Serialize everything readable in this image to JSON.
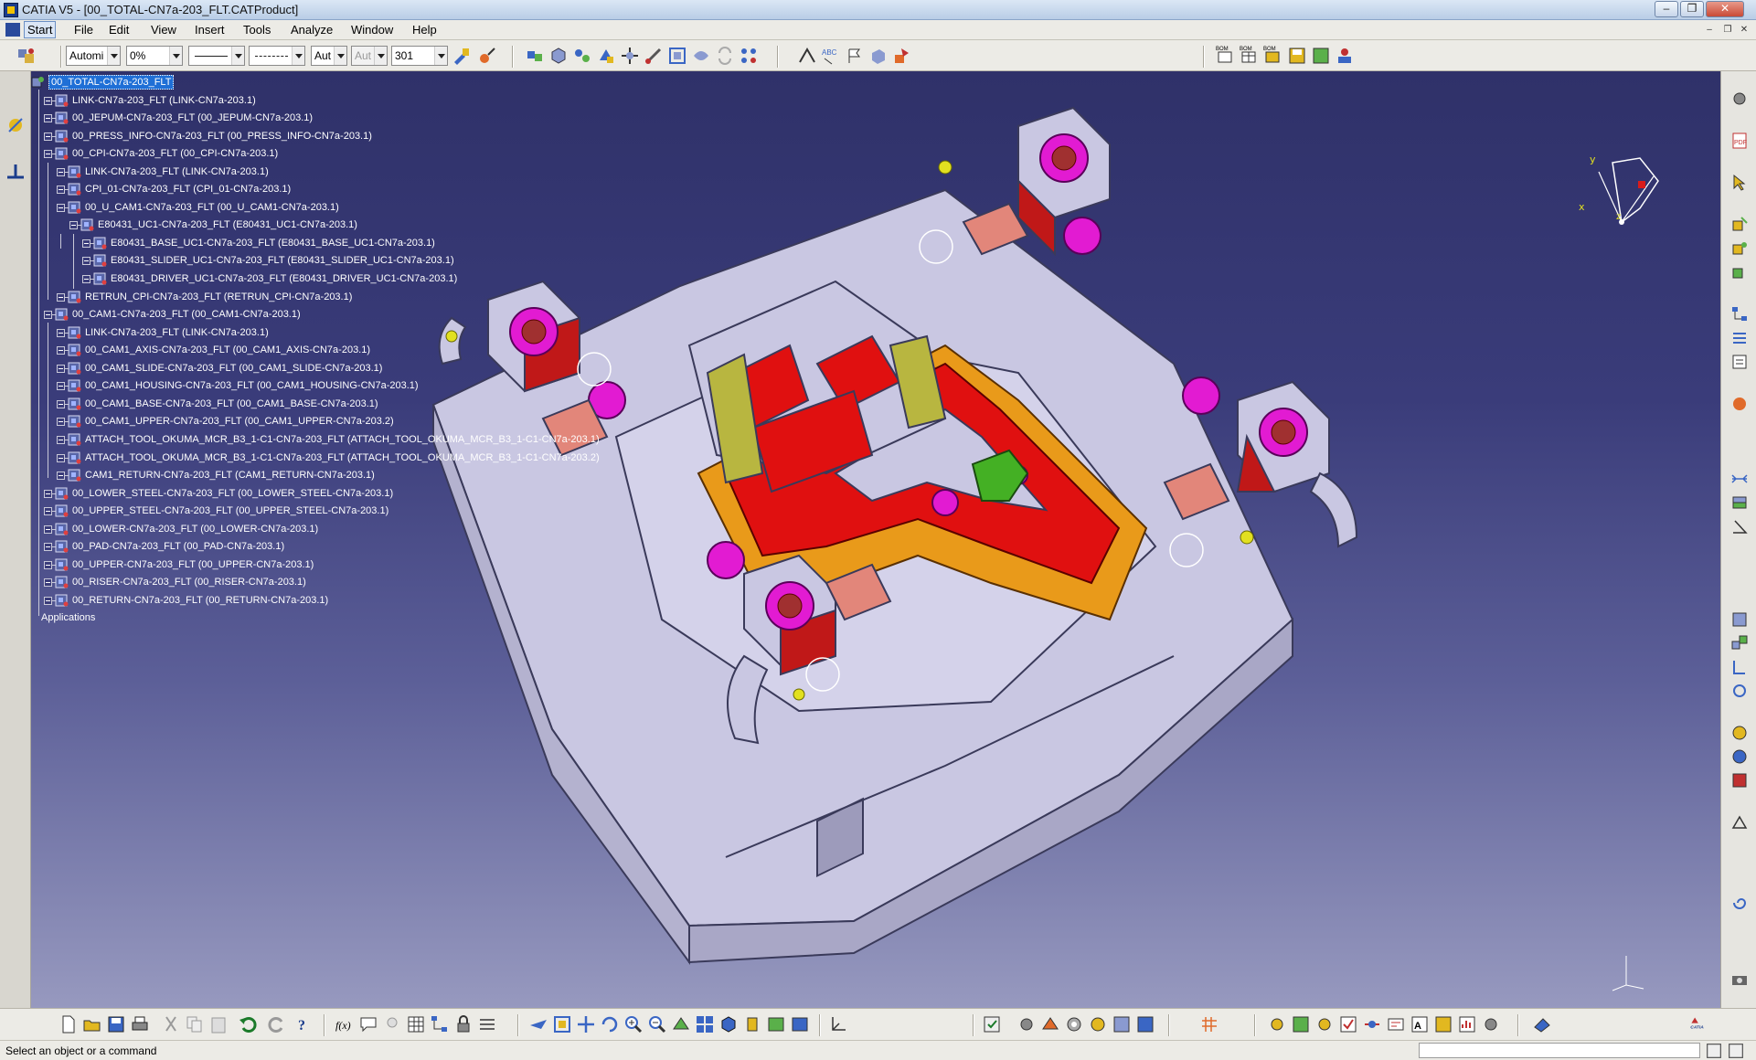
{
  "window": {
    "title": "CATIA V5 - [00_TOTAL-CN7a-203_FLT.CATProduct]",
    "minimize": "–",
    "restore": "❐",
    "close": "✕"
  },
  "menu": {
    "items": [
      "Start",
      "File",
      "Edit",
      "View",
      "Insert",
      "Tools",
      "Analyze",
      "Window",
      "Help"
    ]
  },
  "toolbar": {
    "combo_layer": "Automi",
    "combo_transparency": "0%",
    "combo_weight": "Aut",
    "combo_weight2": "Aut",
    "combo_number": "301"
  },
  "tree": {
    "root": "00_TOTAL-CN7a-203_FLT",
    "nodes": [
      "LINK-CN7a-203_FLT (LINK-CN7a-203.1)",
      "00_JEPUM-CN7a-203_FLT (00_JEPUM-CN7a-203.1)",
      "00_PRESS_INFO-CN7a-203_FLT (00_PRESS_INFO-CN7a-203.1)",
      "00_CPI-CN7a-203_FLT (00_CPI-CN7a-203.1)",
      "LINK-CN7a-203_FLT (LINK-CN7a-203.1)",
      "CPI_01-CN7a-203_FLT (CPI_01-CN7a-203.1)",
      "00_U_CAM1-CN7a-203_FLT (00_U_CAM1-CN7a-203.1)",
      "E80431_UC1-CN7a-203_FLT (E80431_UC1-CN7a-203.1)",
      "E80431_BASE_UC1-CN7a-203_FLT (E80431_BASE_UC1-CN7a-203.1)",
      "E80431_SLIDER_UC1-CN7a-203_FLT (E80431_SLIDER_UC1-CN7a-203.1)",
      "E80431_DRIVER_UC1-CN7a-203_FLT (E80431_DRIVER_UC1-CN7a-203.1)",
      "RETRUN_CPI-CN7a-203_FLT (RETRUN_CPI-CN7a-203.1)",
      "00_CAM1-CN7a-203_FLT (00_CAM1-CN7a-203.1)",
      "LINK-CN7a-203_FLT (LINK-CN7a-203.1)",
      "00_CAM1_AXIS-CN7a-203_FLT (00_CAM1_AXIS-CN7a-203.1)",
      "00_CAM1_SLIDE-CN7a-203_FLT (00_CAM1_SLIDE-CN7a-203.1)",
      "00_CAM1_HOUSING-CN7a-203_FLT (00_CAM1_HOUSING-CN7a-203.1)",
      "00_CAM1_BASE-CN7a-203_FLT (00_CAM1_BASE-CN7a-203.1)",
      "00_CAM1_UPPER-CN7a-203_FLT (00_CAM1_UPPER-CN7a-203.2)",
      "ATTACH_TOOL_OKUMA_MCR_B3_1-C1-CN7a-203_FLT (ATTACH_TOOL_OKUMA_MCR_B3_1-C1-CN7a-203.1)",
      "ATTACH_TOOL_OKUMA_MCR_B3_1-C1-CN7a-203_FLT (ATTACH_TOOL_OKUMA_MCR_B3_1-C1-CN7a-203.2)",
      "CAM1_RETURN-CN7a-203_FLT (CAM1_RETURN-CN7a-203.1)",
      "00_LOWER_STEEL-CN7a-203_FLT (00_LOWER_STEEL-CN7a-203.1)",
      "00_UPPER_STEEL-CN7a-203_FLT (00_UPPER_STEEL-CN7a-203.1)",
      "00_LOWER-CN7a-203_FLT (00_LOWER-CN7a-203.1)",
      "00_PAD-CN7a-203_FLT (00_PAD-CN7a-203.1)",
      "00_UPPER-CN7a-203_FLT (00_UPPER-CN7a-203.1)",
      "00_RISER-CN7a-203_FLT (00_RISER-CN7a-203.1)",
      "00_RETURN-CN7a-203_FLT (00_RETURN-CN7a-203.1)"
    ],
    "applications": "Applications"
  },
  "compass": {
    "x_label": "x",
    "y_label": "y",
    "z_label": "z"
  },
  "status": {
    "message": "Select an object or a command"
  },
  "colors": {
    "viewport_top": "#2f3169",
    "viewport_bottom": "#9799bf",
    "part_grey": "#c8c6e0",
    "part_red": "#e01010",
    "part_orange": "#e99a1a",
    "part_magenta": "#e21bd2",
    "selection_blue": "#1f6fd6"
  }
}
